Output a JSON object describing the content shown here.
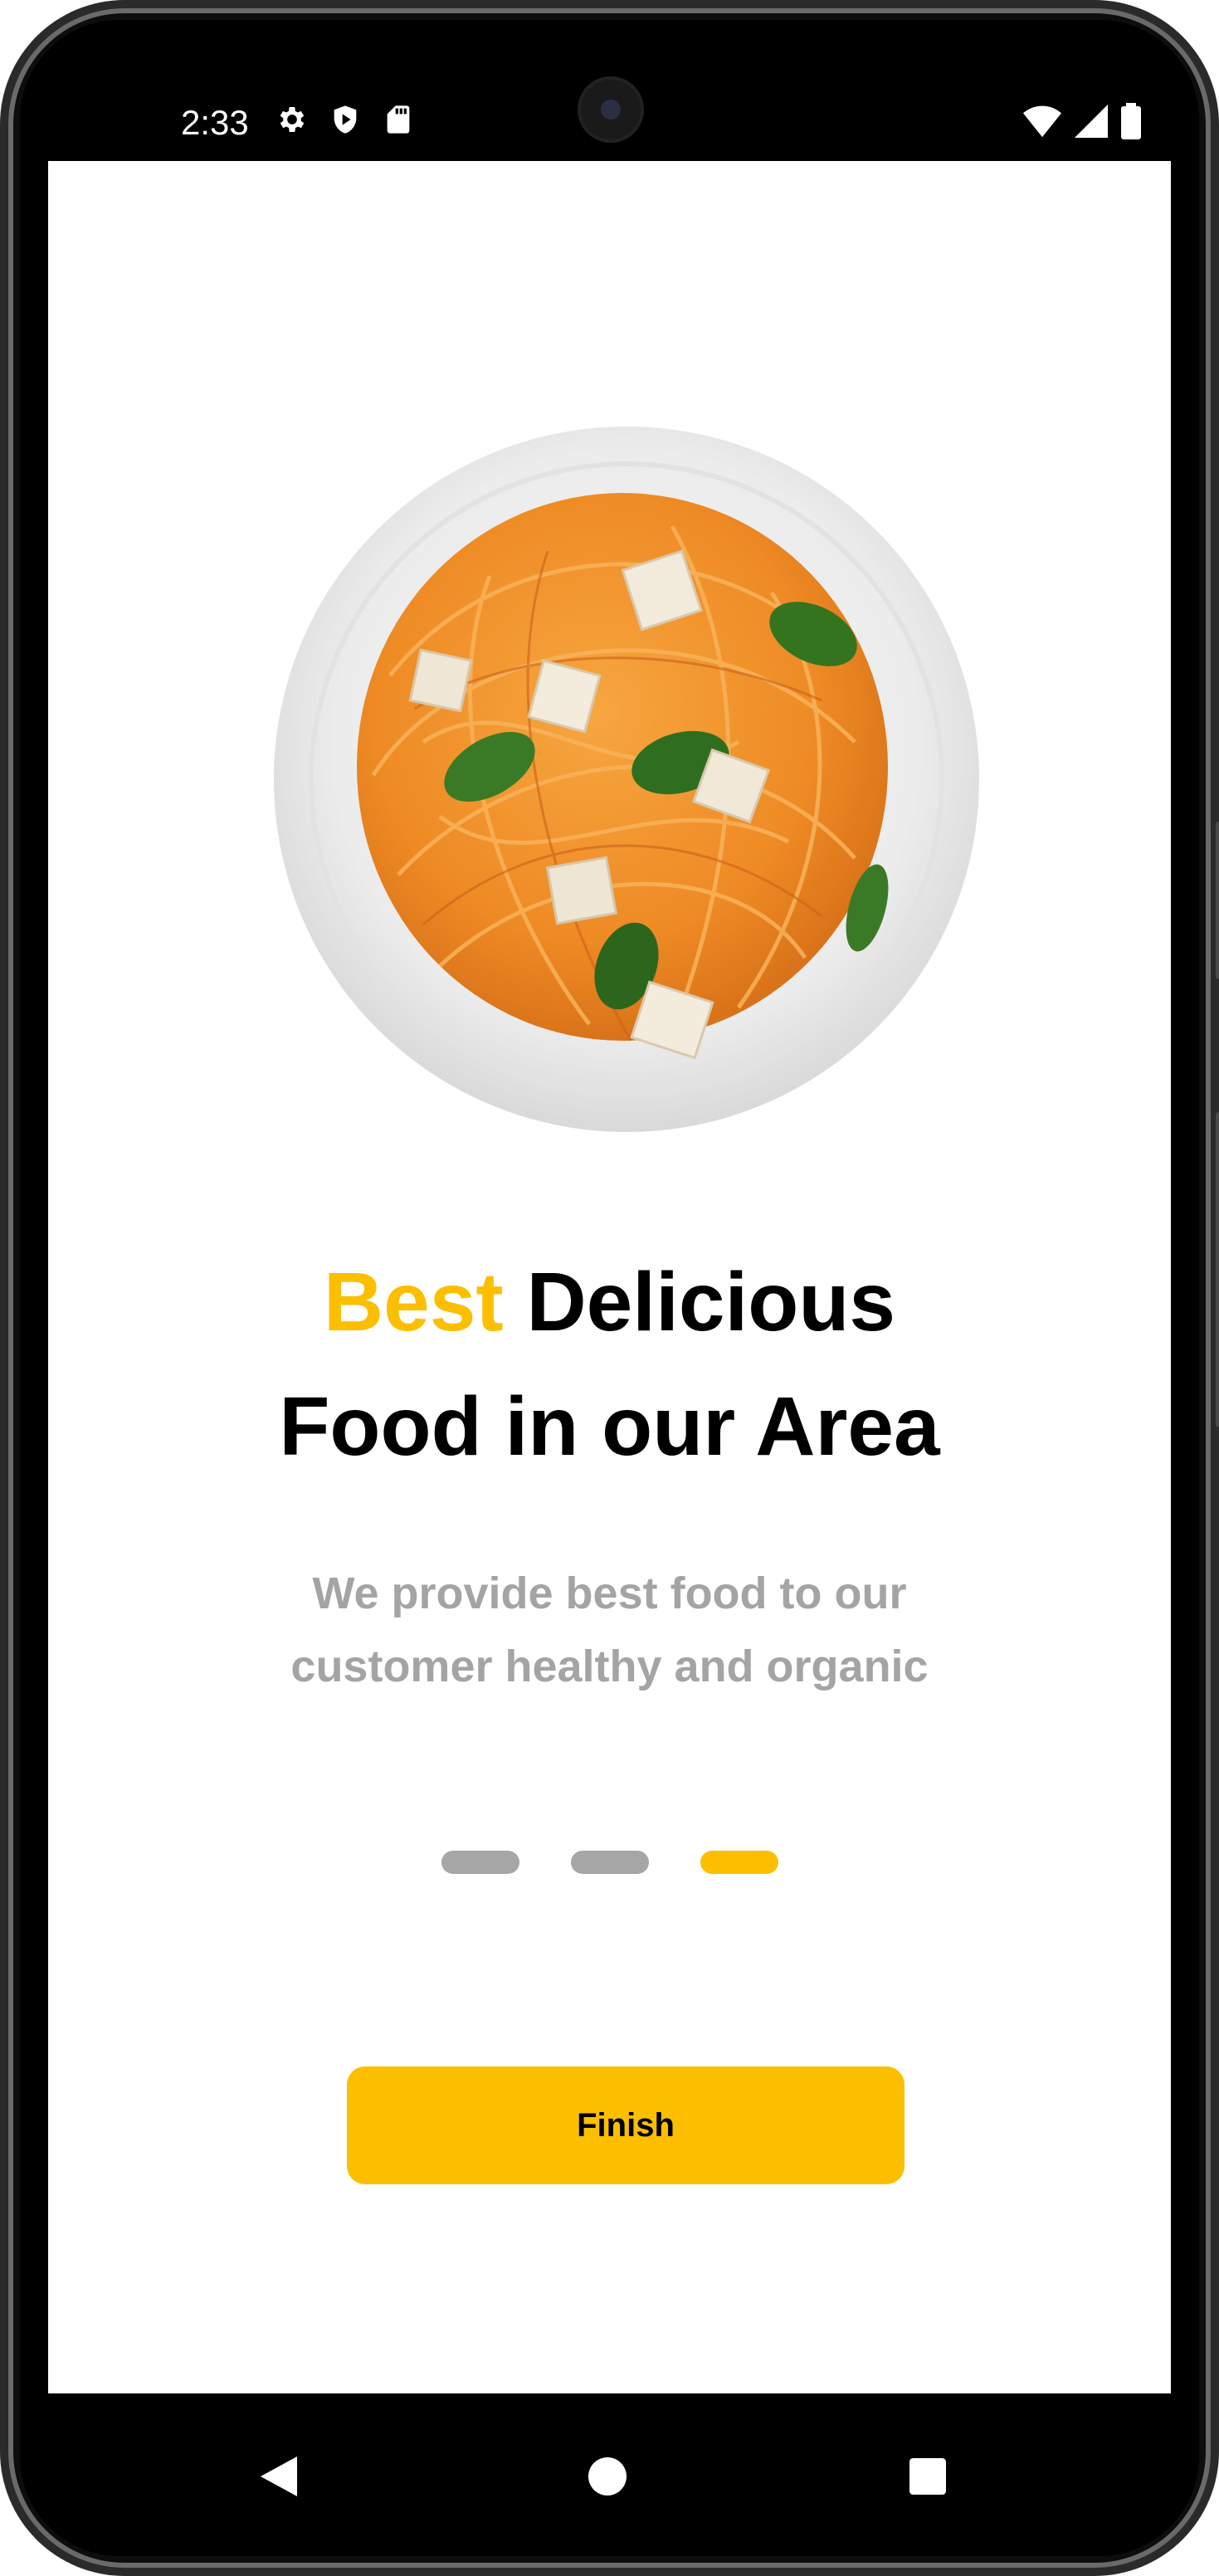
{
  "status_bar": {
    "time": "2:33",
    "left_icons": [
      "gear-icon",
      "shield-play-icon",
      "sd-card-icon"
    ],
    "right_icons": [
      "wifi-icon",
      "cell-signal-icon",
      "battery-icon"
    ]
  },
  "onboarding": {
    "title_accent": "Best",
    "title_rest_line1": "Delicious",
    "title_line2": "Food in our Area",
    "subtitle_line1": "We provide best food to our",
    "subtitle_line2": "customer healthy and organic",
    "page_count": 3,
    "current_page": 3,
    "finish_label": "Finish"
  },
  "colors": {
    "accent": "#fbbf00",
    "subtitle": "#a4a4a4",
    "dot_inactive": "#a6a6a6"
  },
  "nav_bar": {
    "icons": [
      "back-icon",
      "home-icon",
      "recents-icon"
    ]
  }
}
